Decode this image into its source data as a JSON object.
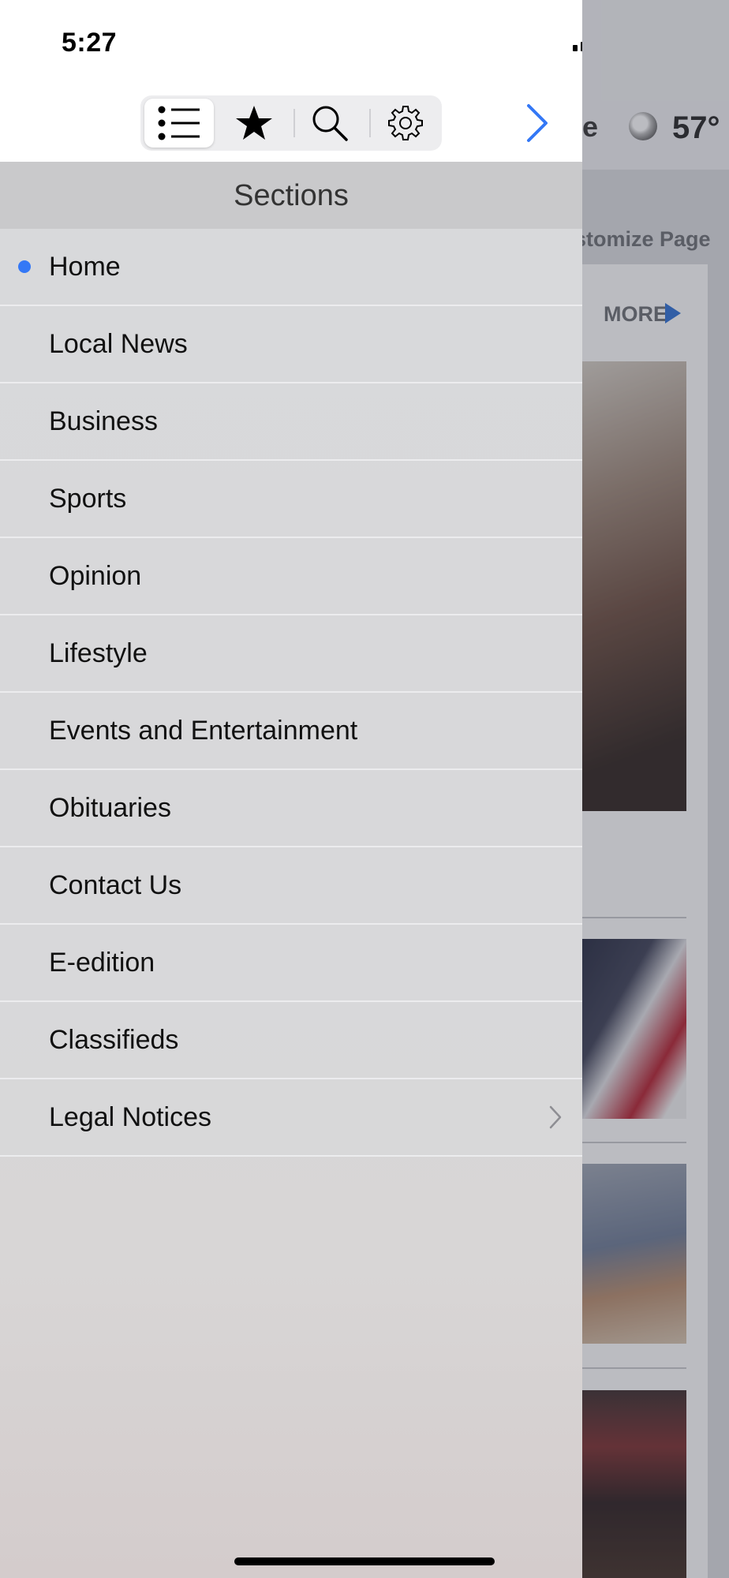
{
  "status_bar": {
    "time": "5:27"
  },
  "background": {
    "header_peek": "e",
    "temperature": "57°",
    "customize_label": "stomize Page",
    "more_label": "MORE"
  },
  "toolbar": {
    "tabs": [
      {
        "icon": "list-icon",
        "selected": true
      },
      {
        "icon": "star-icon",
        "selected": false
      },
      {
        "icon": "search-icon",
        "selected": false
      },
      {
        "icon": "gear-icon",
        "selected": false
      }
    ],
    "forward_icon": "chevron-right-icon"
  },
  "sections": {
    "title": "Sections",
    "items": [
      {
        "label": "Home",
        "active": true
      },
      {
        "label": "Local News"
      },
      {
        "label": "Business"
      },
      {
        "label": "Sports"
      },
      {
        "label": "Opinion"
      },
      {
        "label": "Lifestyle"
      },
      {
        "label": "Events and Entertainment"
      },
      {
        "label": "Obituaries"
      },
      {
        "label": "Contact Us"
      },
      {
        "label": "E-edition"
      },
      {
        "label": "Classifieds"
      },
      {
        "label": "Legal Notices",
        "has_submenu": true
      }
    ]
  },
  "colors": {
    "accent": "#3478f6",
    "header_band": "#c9c9cb",
    "more_arrow": "#2b6fd6"
  }
}
